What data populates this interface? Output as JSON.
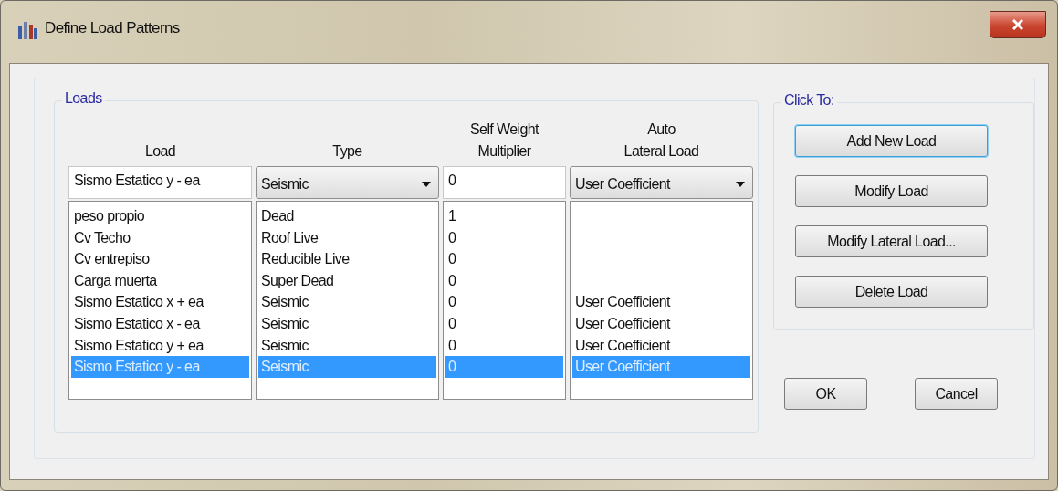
{
  "window": {
    "title": "Define Load Patterns"
  },
  "loads": {
    "title": "Loads",
    "headers": [
      "Load",
      "Type",
      "Self Weight\nMultiplier",
      "Auto\nLateral Load"
    ],
    "edit": {
      "load": "Sismo Estatico y - ea",
      "type": "Seismic",
      "multiplier": "0",
      "lateral": "User Coefficient"
    },
    "rows": [
      {
        "load": "peso propio",
        "type": "Dead",
        "multiplier": "1",
        "selected": false
      },
      {
        "load": "Cv Techo",
        "type": "Roof Live",
        "multiplier": "0",
        "selected": false
      },
      {
        "load": "Cv entrepiso",
        "type": "Reducible Live",
        "multiplier": "0",
        "selected": false
      },
      {
        "load": "Carga muerta",
        "type": "Super Dead",
        "multiplier": "0",
        "selected": false
      },
      {
        "load": "Sismo Estatico x + ea",
        "type": "Seismic",
        "multiplier": "0",
        "lateral": "User Coefficient",
        "selected": false
      },
      {
        "load": "Sismo Estatico x - ea",
        "type": "Seismic",
        "multiplier": "0",
        "lateral": "User Coefficient",
        "selected": false
      },
      {
        "load": "Sismo Estatico y + ea",
        "type": "Seismic",
        "multiplier": "0",
        "lateral": "User Coefficient",
        "selected": false
      },
      {
        "load": "Sismo Estatico y - ea",
        "type": "Seismic",
        "multiplier": "0",
        "lateral": "User Coefficient",
        "selected": true
      }
    ]
  },
  "click_to": {
    "title": "Click To:",
    "buttons": [
      {
        "label": "Add New Load",
        "focused": true
      },
      {
        "label": "Modify Load",
        "focused": false
      },
      {
        "label": "Modify Lateral Load...",
        "focused": false
      },
      {
        "label": "Delete Load",
        "focused": false
      }
    ]
  },
  "dialog_buttons": [
    "OK",
    "Cancel"
  ]
}
